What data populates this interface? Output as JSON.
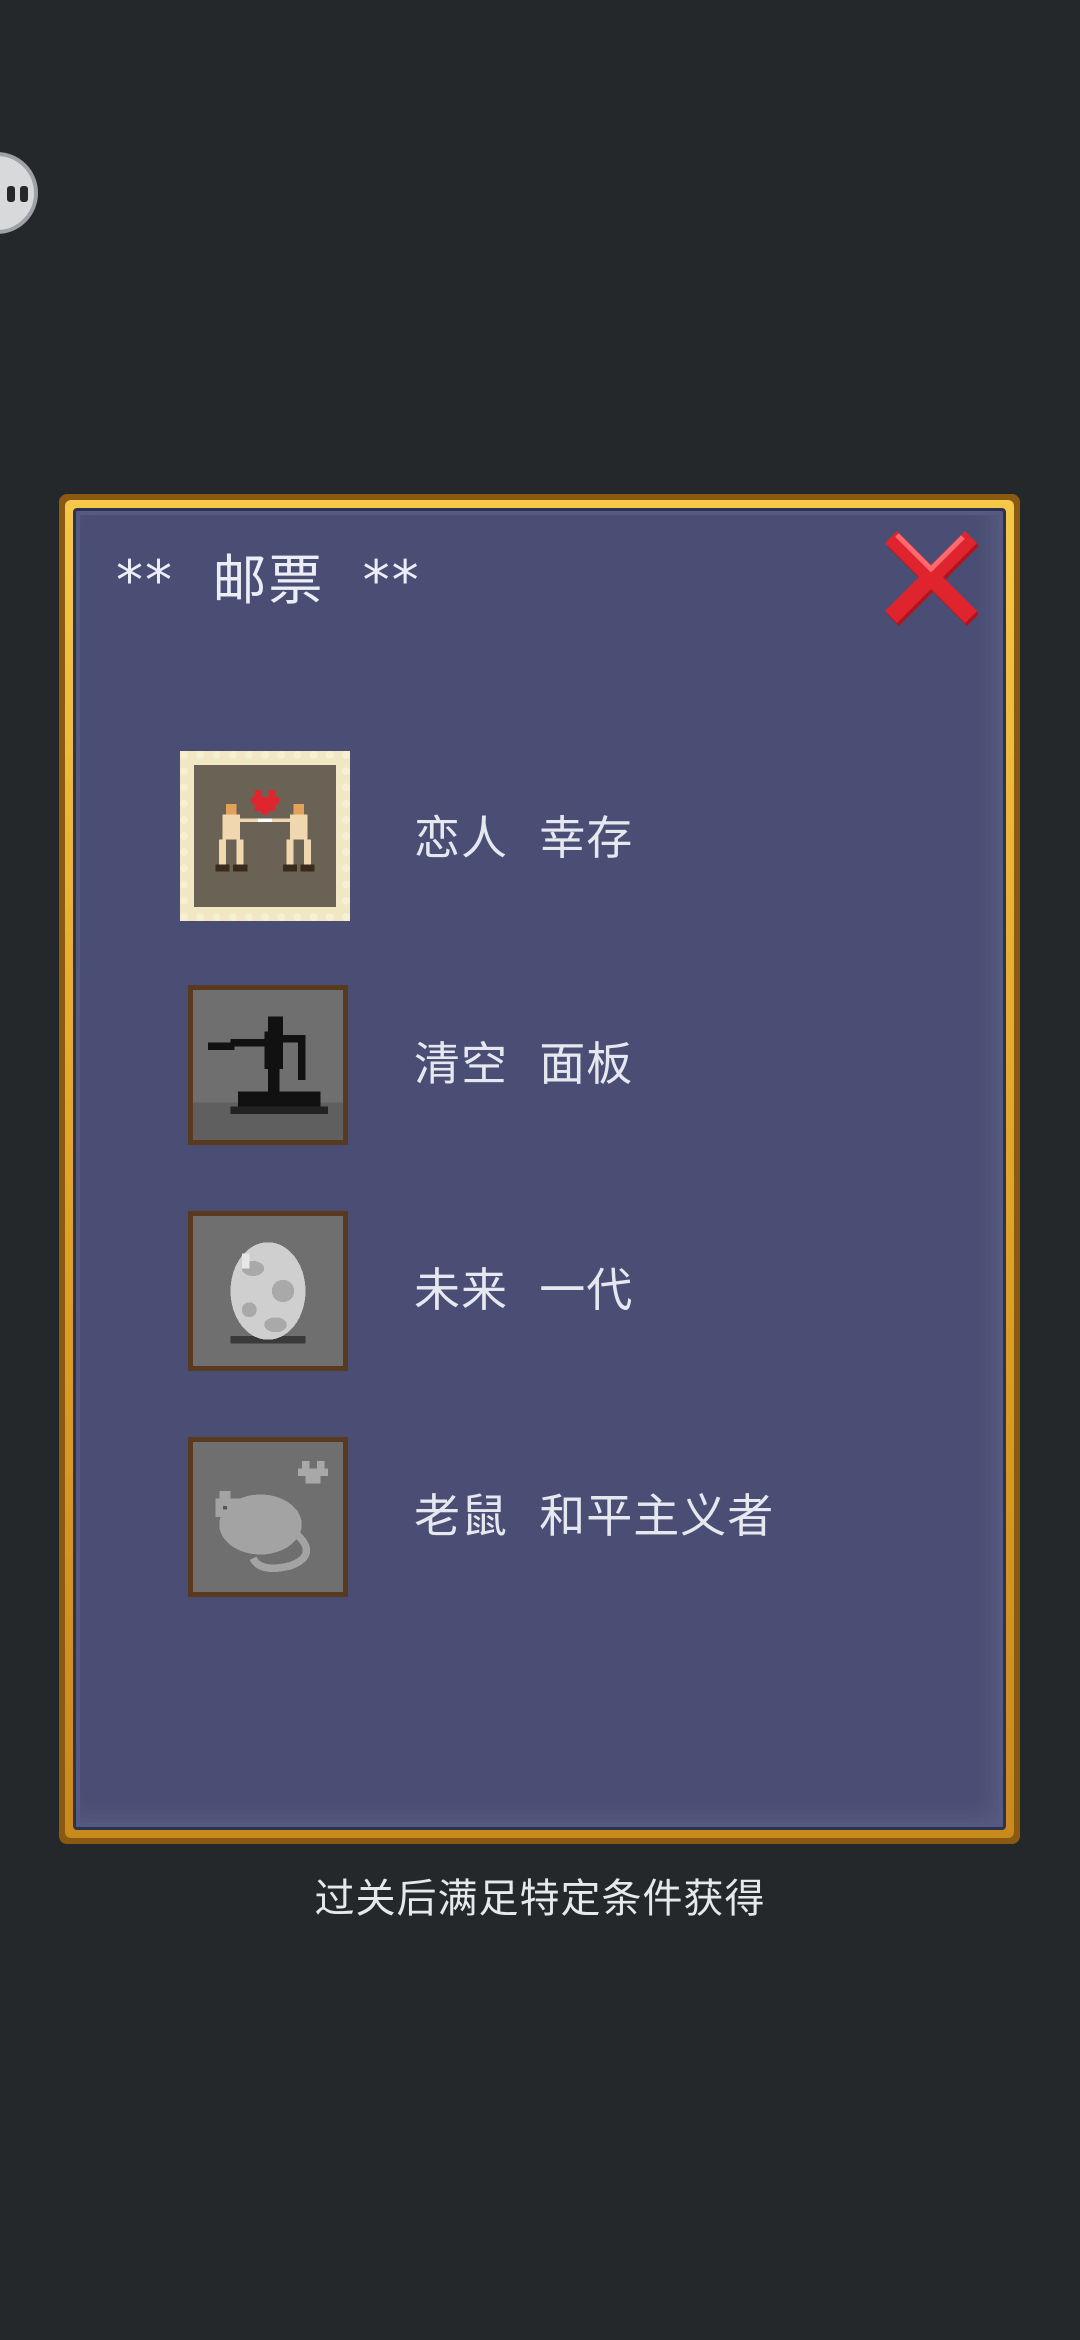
{
  "panel": {
    "title": "**  邮票  **",
    "close_icon": "close-x-icon"
  },
  "stamps": [
    {
      "label": "恋人  幸存",
      "icon": "lovers-duel-stamp-icon",
      "state": "unlocked"
    },
    {
      "label": "清空  面板",
      "icon": "silhouette-figure-stamp-icon",
      "state": "locked"
    },
    {
      "label": "未来  一代",
      "icon": "egg-stamp-icon",
      "state": "locked"
    },
    {
      "label": "老鼠  和平主义者",
      "icon": "rat-heart-stamp-icon",
      "state": "locked"
    }
  ],
  "hint": "过关后满足特定条件获得",
  "colors": {
    "background": "#25282b",
    "panel_fill": "#4a4e74",
    "frame_gold": "#e0a52a",
    "close_red": "#d8202c"
  }
}
